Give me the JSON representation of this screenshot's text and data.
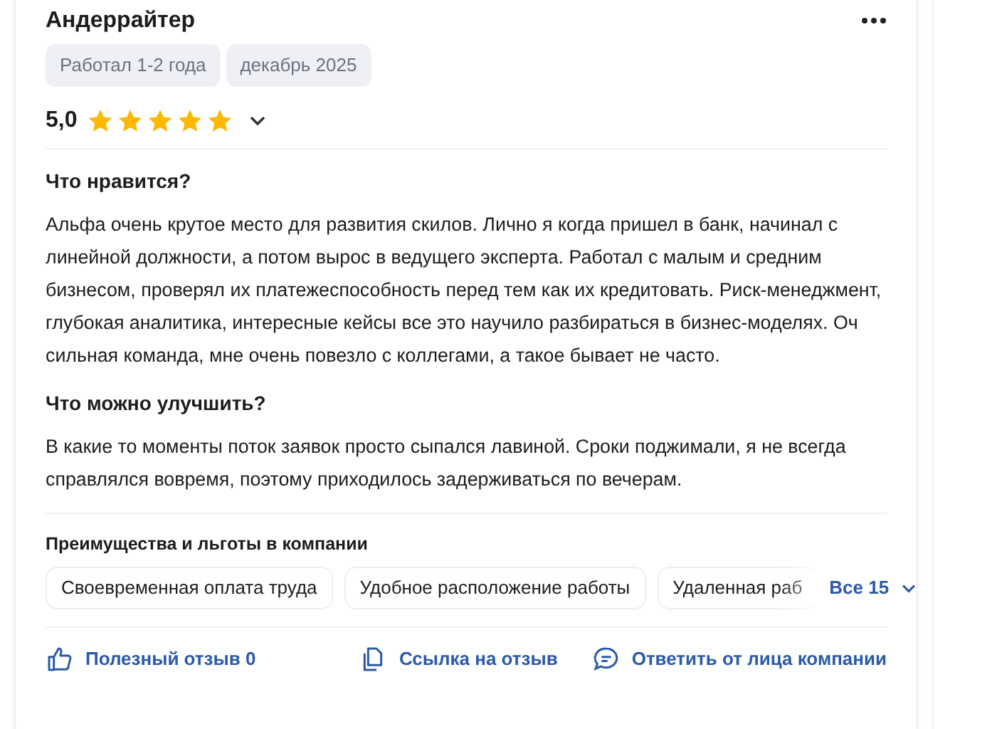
{
  "review": {
    "title": "Андеррайтер",
    "tags": [
      "Работал 1-2 года",
      "декабрь 2025"
    ],
    "rating": "5,0",
    "stars": 5,
    "sections": [
      {
        "heading": "Что нравится?",
        "text": "Альфа очень крутое место для развития скилов. Лично я когда пришел в банк, начинал с линейной должности, а потом вырос в ведущего эксперта. Работал с малым и средним бизнесом, проверял их платежеспособность перед тем как их кредитовать. Риск-менеджмент, глубокая аналитика, интересные кейсы все это научило разбираться в бизнес-моделях. Оч сильная команда, мне очень повезло с коллегами, а такое бывает не часто."
      },
      {
        "heading": "Что можно улучшить?",
        "text": "В какие то моменты поток заявок просто сыпался лавиной. Сроки поджимали, я не всегда справлялся вовремя, поэтому приходилось задерживаться по вечерам."
      }
    ],
    "benefits": {
      "heading": "Преимущества и льготы в компании",
      "chips": [
        "Своевременная оплата труда",
        "Удобное расположение работы",
        "Удаленная раб"
      ],
      "more": "Все 15"
    },
    "actions": [
      {
        "kind": "like",
        "label": "Полезный отзыв 0"
      },
      {
        "kind": "link",
        "label": "Ссылка на отзыв"
      },
      {
        "kind": "reply",
        "label": "Ответить от лица компании"
      }
    ]
  }
}
